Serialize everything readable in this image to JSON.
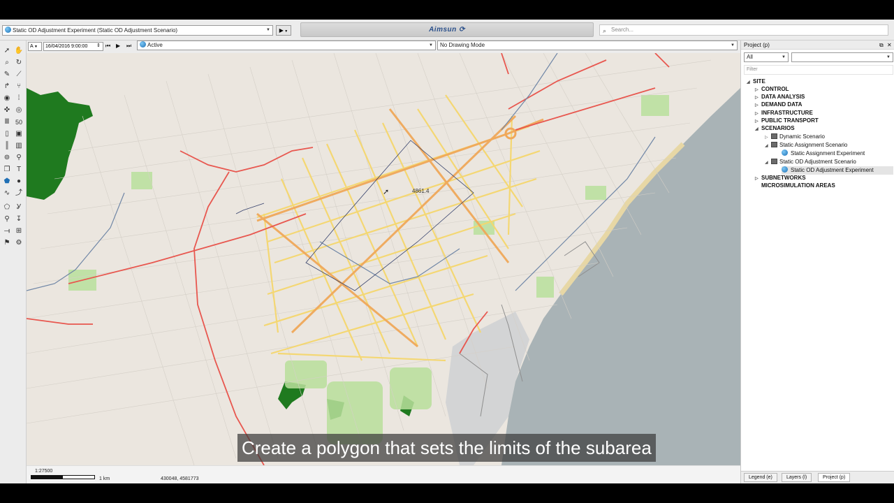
{
  "toolbar": {
    "experiment": "Static OD Adjustment Experiment (Static OD Adjustment Scenario)",
    "play_glyph": "▶",
    "logo": "Aimsun",
    "search_placeholder": "Search..."
  },
  "timebar": {
    "mode": "A",
    "datetime": "16/04/2016 9:00:00",
    "state": "Active",
    "drawing_mode": "No Drawing Mode"
  },
  "map": {
    "label": "4861.4",
    "caption": "Create a polygon that sets the limits of the subarea"
  },
  "status": {
    "scale": "1:27500",
    "scale_unit": "1 km",
    "coords": "430048, 4581773"
  },
  "panel": {
    "title": "Project (p)",
    "filter_all": "All",
    "filter_placeholder": "Filter",
    "tree": {
      "site": "SITE",
      "control": "CONTROL",
      "data_analysis": "DATA ANALYSIS",
      "demand_data": "DEMAND DATA",
      "infrastructure": "INFRASTRUCTURE",
      "public_transport": "PUBLIC TRANSPORT",
      "scenarios": "SCENARIOS",
      "dynamic_scenario": "Dynamic Scenario",
      "static_assignment_scenario": "Static Assignment Scenario",
      "static_assignment_experiment": "Static Assignment Experiment",
      "static_od_scenario": "Static OD Adjustment Scenario",
      "static_od_experiment": "Static OD Adjustment Experiment",
      "subnetworks": "SUBNETWORKS",
      "microsim_areas": "MICROSIMULATION AREAS"
    },
    "tabs": {
      "legend": "Legend (e)",
      "layers": "Layers (l)",
      "project": "Project (p)"
    }
  },
  "colors": {
    "sea": "#a9b3b6",
    "land": "#ebe6df",
    "primary": "#f5d76e",
    "motorway": "#e8574f",
    "arterial": "#f0a85a",
    "park": "#b9df9c",
    "forest": "#1f7a1f"
  }
}
